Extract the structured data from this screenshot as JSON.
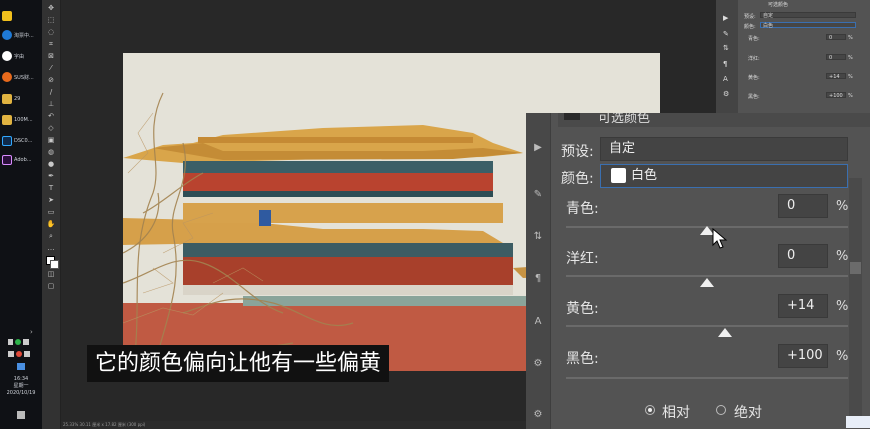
{
  "taskbar": {
    "apps": [
      {
        "label": "",
        "color": "#f2c01d"
      },
      {
        "label": "淘票中...",
        "color": "#1f7ad6"
      },
      {
        "label": "字由",
        "color": "#1a1a1a"
      },
      {
        "label": "SUS财...",
        "color": "#e86a1c"
      },
      {
        "label": "29",
        "color": "#e0b341"
      },
      {
        "label": "100M...",
        "color": "#e0b341"
      },
      {
        "label": "DSC0...",
        "color": "#0f2a4a"
      },
      {
        "label": "Adob...",
        "color": "#2a0f3a"
      }
    ],
    "clock_time": "16:34",
    "clock_day": "星期一",
    "clock_date": "2020/10/19"
  },
  "statusbar": {
    "text": "25.33%  30.11 厘米 x 17.82 厘米 (300 ppi)"
  },
  "small_panel": {
    "title": "可选颜色",
    "preset_label": "预设:",
    "preset_value": "自定",
    "colors_label": "颜色:",
    "colors_value": "白色",
    "rows": [
      {
        "label": "青色:",
        "value": "0",
        "pct": "%"
      },
      {
        "label": "洋红:",
        "value": "0",
        "pct": "%"
      },
      {
        "label": "黄色:",
        "value": "+14",
        "pct": "%"
      },
      {
        "label": "黑色:",
        "value": "+100",
        "pct": "%"
      }
    ]
  },
  "properties": {
    "header_title": "可选颜色",
    "preset_label": "预设:",
    "preset_value": "自定",
    "colors_label": "颜色:",
    "colors_value": "白色",
    "sliders": [
      {
        "label": "青色:",
        "value": "0",
        "pct": "%",
        "position": 0.5
      },
      {
        "label": "洋红:",
        "value": "0",
        "pct": "%",
        "position": 0.5
      },
      {
        "label": "黄色:",
        "value": "+14",
        "pct": "%",
        "position": 0.57
      },
      {
        "label": "黑色:",
        "value": "+100",
        "pct": "%",
        "position": 1.0
      }
    ],
    "method_relative": "相对",
    "method_absolute": "绝对"
  },
  "subtitle": "它的颜色偏向让他有一些偏黄",
  "colors": {
    "accent_selected": "#3a6fb0"
  }
}
